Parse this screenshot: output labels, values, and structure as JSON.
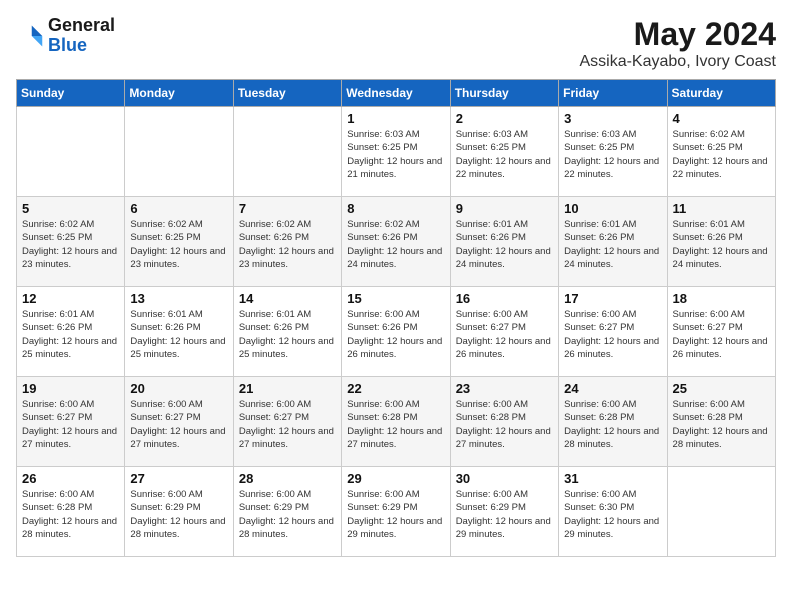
{
  "header": {
    "logo_line1": "General",
    "logo_line2": "Blue",
    "month_year": "May 2024",
    "location": "Assika-Kayabo, Ivory Coast"
  },
  "weekdays": [
    "Sunday",
    "Monday",
    "Tuesday",
    "Wednesday",
    "Thursday",
    "Friday",
    "Saturday"
  ],
  "weeks": [
    [
      {
        "day": "",
        "sunrise": "",
        "sunset": "",
        "daylight": ""
      },
      {
        "day": "",
        "sunrise": "",
        "sunset": "",
        "daylight": ""
      },
      {
        "day": "",
        "sunrise": "",
        "sunset": "",
        "daylight": ""
      },
      {
        "day": "1",
        "sunrise": "Sunrise: 6:03 AM",
        "sunset": "Sunset: 6:25 PM",
        "daylight": "Daylight: 12 hours and 21 minutes."
      },
      {
        "day": "2",
        "sunrise": "Sunrise: 6:03 AM",
        "sunset": "Sunset: 6:25 PM",
        "daylight": "Daylight: 12 hours and 22 minutes."
      },
      {
        "day": "3",
        "sunrise": "Sunrise: 6:03 AM",
        "sunset": "Sunset: 6:25 PM",
        "daylight": "Daylight: 12 hours and 22 minutes."
      },
      {
        "day": "4",
        "sunrise": "Sunrise: 6:02 AM",
        "sunset": "Sunset: 6:25 PM",
        "daylight": "Daylight: 12 hours and 22 minutes."
      }
    ],
    [
      {
        "day": "5",
        "sunrise": "Sunrise: 6:02 AM",
        "sunset": "Sunset: 6:25 PM",
        "daylight": "Daylight: 12 hours and 23 minutes."
      },
      {
        "day": "6",
        "sunrise": "Sunrise: 6:02 AM",
        "sunset": "Sunset: 6:25 PM",
        "daylight": "Daylight: 12 hours and 23 minutes."
      },
      {
        "day": "7",
        "sunrise": "Sunrise: 6:02 AM",
        "sunset": "Sunset: 6:26 PM",
        "daylight": "Daylight: 12 hours and 23 minutes."
      },
      {
        "day": "8",
        "sunrise": "Sunrise: 6:02 AM",
        "sunset": "Sunset: 6:26 PM",
        "daylight": "Daylight: 12 hours and 24 minutes."
      },
      {
        "day": "9",
        "sunrise": "Sunrise: 6:01 AM",
        "sunset": "Sunset: 6:26 PM",
        "daylight": "Daylight: 12 hours and 24 minutes."
      },
      {
        "day": "10",
        "sunrise": "Sunrise: 6:01 AM",
        "sunset": "Sunset: 6:26 PM",
        "daylight": "Daylight: 12 hours and 24 minutes."
      },
      {
        "day": "11",
        "sunrise": "Sunrise: 6:01 AM",
        "sunset": "Sunset: 6:26 PM",
        "daylight": "Daylight: 12 hours and 24 minutes."
      }
    ],
    [
      {
        "day": "12",
        "sunrise": "Sunrise: 6:01 AM",
        "sunset": "Sunset: 6:26 PM",
        "daylight": "Daylight: 12 hours and 25 minutes."
      },
      {
        "day": "13",
        "sunrise": "Sunrise: 6:01 AM",
        "sunset": "Sunset: 6:26 PM",
        "daylight": "Daylight: 12 hours and 25 minutes."
      },
      {
        "day": "14",
        "sunrise": "Sunrise: 6:01 AM",
        "sunset": "Sunset: 6:26 PM",
        "daylight": "Daylight: 12 hours and 25 minutes."
      },
      {
        "day": "15",
        "sunrise": "Sunrise: 6:00 AM",
        "sunset": "Sunset: 6:26 PM",
        "daylight": "Daylight: 12 hours and 26 minutes."
      },
      {
        "day": "16",
        "sunrise": "Sunrise: 6:00 AM",
        "sunset": "Sunset: 6:27 PM",
        "daylight": "Daylight: 12 hours and 26 minutes."
      },
      {
        "day": "17",
        "sunrise": "Sunrise: 6:00 AM",
        "sunset": "Sunset: 6:27 PM",
        "daylight": "Daylight: 12 hours and 26 minutes."
      },
      {
        "day": "18",
        "sunrise": "Sunrise: 6:00 AM",
        "sunset": "Sunset: 6:27 PM",
        "daylight": "Daylight: 12 hours and 26 minutes."
      }
    ],
    [
      {
        "day": "19",
        "sunrise": "Sunrise: 6:00 AM",
        "sunset": "Sunset: 6:27 PM",
        "daylight": "Daylight: 12 hours and 27 minutes."
      },
      {
        "day": "20",
        "sunrise": "Sunrise: 6:00 AM",
        "sunset": "Sunset: 6:27 PM",
        "daylight": "Daylight: 12 hours and 27 minutes."
      },
      {
        "day": "21",
        "sunrise": "Sunrise: 6:00 AM",
        "sunset": "Sunset: 6:27 PM",
        "daylight": "Daylight: 12 hours and 27 minutes."
      },
      {
        "day": "22",
        "sunrise": "Sunrise: 6:00 AM",
        "sunset": "Sunset: 6:28 PM",
        "daylight": "Daylight: 12 hours and 27 minutes."
      },
      {
        "day": "23",
        "sunrise": "Sunrise: 6:00 AM",
        "sunset": "Sunset: 6:28 PM",
        "daylight": "Daylight: 12 hours and 27 minutes."
      },
      {
        "day": "24",
        "sunrise": "Sunrise: 6:00 AM",
        "sunset": "Sunset: 6:28 PM",
        "daylight": "Daylight: 12 hours and 28 minutes."
      },
      {
        "day": "25",
        "sunrise": "Sunrise: 6:00 AM",
        "sunset": "Sunset: 6:28 PM",
        "daylight": "Daylight: 12 hours and 28 minutes."
      }
    ],
    [
      {
        "day": "26",
        "sunrise": "Sunrise: 6:00 AM",
        "sunset": "Sunset: 6:28 PM",
        "daylight": "Daylight: 12 hours and 28 minutes."
      },
      {
        "day": "27",
        "sunrise": "Sunrise: 6:00 AM",
        "sunset": "Sunset: 6:29 PM",
        "daylight": "Daylight: 12 hours and 28 minutes."
      },
      {
        "day": "28",
        "sunrise": "Sunrise: 6:00 AM",
        "sunset": "Sunset: 6:29 PM",
        "daylight": "Daylight: 12 hours and 28 minutes."
      },
      {
        "day": "29",
        "sunrise": "Sunrise: 6:00 AM",
        "sunset": "Sunset: 6:29 PM",
        "daylight": "Daylight: 12 hours and 29 minutes."
      },
      {
        "day": "30",
        "sunrise": "Sunrise: 6:00 AM",
        "sunset": "Sunset: 6:29 PM",
        "daylight": "Daylight: 12 hours and 29 minutes."
      },
      {
        "day": "31",
        "sunrise": "Sunrise: 6:00 AM",
        "sunset": "Sunset: 6:30 PM",
        "daylight": "Daylight: 12 hours and 29 minutes."
      },
      {
        "day": "",
        "sunrise": "",
        "sunset": "",
        "daylight": ""
      }
    ]
  ]
}
